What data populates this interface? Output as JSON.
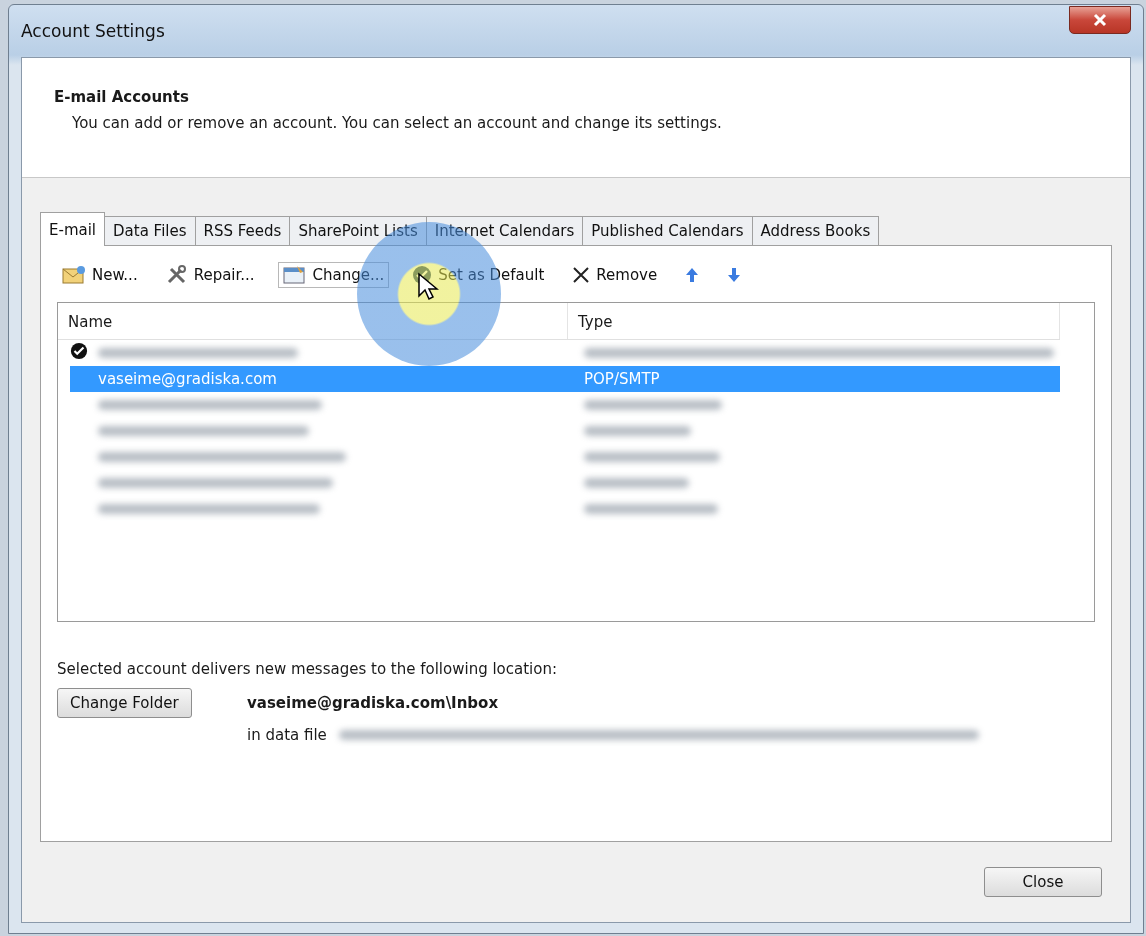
{
  "window": {
    "title": "Account Settings"
  },
  "header": {
    "title": "E-mail Accounts",
    "description": "You can add or remove an account. You can select an account and change its settings."
  },
  "tabs": [
    {
      "label": "E-mail",
      "selected": true
    },
    {
      "label": "Data Files",
      "selected": false
    },
    {
      "label": "RSS Feeds",
      "selected": false
    },
    {
      "label": "SharePoint Lists",
      "selected": false
    },
    {
      "label": "Internet Calendars",
      "selected": false
    },
    {
      "label": "Published Calendars",
      "selected": false
    },
    {
      "label": "Address Books",
      "selected": false
    }
  ],
  "toolbar": [
    {
      "kind": "new",
      "label": "New..."
    },
    {
      "kind": "repair",
      "label": "Repair..."
    },
    {
      "kind": "change",
      "label": "Change..."
    },
    {
      "kind": "default",
      "label": "Set as Default"
    },
    {
      "kind": "remove",
      "label": "Remove"
    },
    {
      "kind": "up"
    },
    {
      "kind": "down"
    }
  ],
  "table": {
    "columns": [
      "Name",
      "Type"
    ],
    "rows": [
      {
        "kind": "blurred",
        "default": true,
        "selected": false
      },
      {
        "kind": "text",
        "name": "vaseime@gradiska.com",
        "type": "POP/SMTP",
        "default": false,
        "selected": true
      },
      {
        "kind": "blurred",
        "default": false,
        "selected": false
      },
      {
        "kind": "blurred",
        "default": false,
        "selected": false
      },
      {
        "kind": "blurred",
        "default": false,
        "selected": false
      },
      {
        "kind": "blurred",
        "default": false,
        "selected": false
      },
      {
        "kind": "blurred",
        "default": false,
        "selected": false
      }
    ]
  },
  "location": {
    "caption": "Selected account delivers new messages to the following location:",
    "button": "Change Folder",
    "folder": "vaseime@gradiska.com\\Inbox",
    "data_file_label": "in data file"
  },
  "buttons": [
    "Close"
  ]
}
